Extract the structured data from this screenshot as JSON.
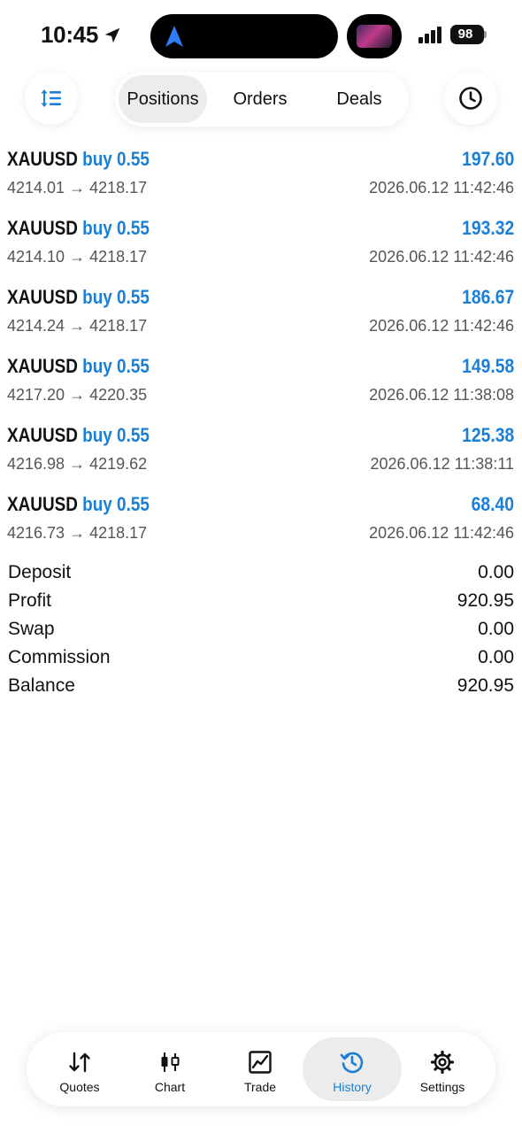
{
  "status": {
    "time": "10:45",
    "battery": "98"
  },
  "header": {
    "tabs": [
      {
        "label": "Positions"
      },
      {
        "label": "Orders"
      },
      {
        "label": "Deals"
      }
    ]
  },
  "positions": [
    {
      "symbol": "XAUUSD",
      "direction": "buy 0.55",
      "open": "4214.01",
      "arrow": "→",
      "close": "4218.17",
      "profit": "197.60",
      "time": "2026.06.12 11:42:46"
    },
    {
      "symbol": "XAUUSD",
      "direction": "buy 0.55",
      "open": "4214.10",
      "arrow": "→",
      "close": "4218.17",
      "profit": "193.32",
      "time": "2026.06.12 11:42:46"
    },
    {
      "symbol": "XAUUSD",
      "direction": "buy 0.55",
      "open": "4214.24",
      "arrow": "→",
      "close": "4218.17",
      "profit": "186.67",
      "time": "2026.06.12 11:42:46"
    },
    {
      "symbol": "XAUUSD",
      "direction": "buy 0.55",
      "open": "4217.20",
      "arrow": "→",
      "close": "4220.35",
      "profit": "149.58",
      "time": "2026.06.12 11:38:08"
    },
    {
      "symbol": "XAUUSD",
      "direction": "buy 0.55",
      "open": "4216.98",
      "arrow": "→",
      "close": "4219.62",
      "profit": "125.38",
      "time": "2026.06.12 11:38:11"
    },
    {
      "symbol": "XAUUSD",
      "direction": "buy 0.55",
      "open": "4216.73",
      "arrow": "→",
      "close": "4218.17",
      "profit": "68.40",
      "time": "2026.06.12 11:42:46"
    }
  ],
  "summary": [
    {
      "label": "Deposit",
      "value": "0.00"
    },
    {
      "label": "Profit",
      "value": "920.95"
    },
    {
      "label": "Swap",
      "value": "0.00"
    },
    {
      "label": "Commission",
      "value": "0.00"
    },
    {
      "label": "Balance",
      "value": "920.95"
    }
  ],
  "tabbar": [
    {
      "label": "Quotes",
      "icon": "quotes-icon"
    },
    {
      "label": "Chart",
      "icon": "chart-candles-icon"
    },
    {
      "label": "Trade",
      "icon": "trade-icon"
    },
    {
      "label": "History",
      "icon": "history-icon",
      "active": true
    },
    {
      "label": "Settings",
      "icon": "gear-icon"
    }
  ],
  "colors": {
    "accent": "#1a7fd6",
    "text": "#111111",
    "muted": "#555555",
    "active_bg": "#ececec"
  }
}
